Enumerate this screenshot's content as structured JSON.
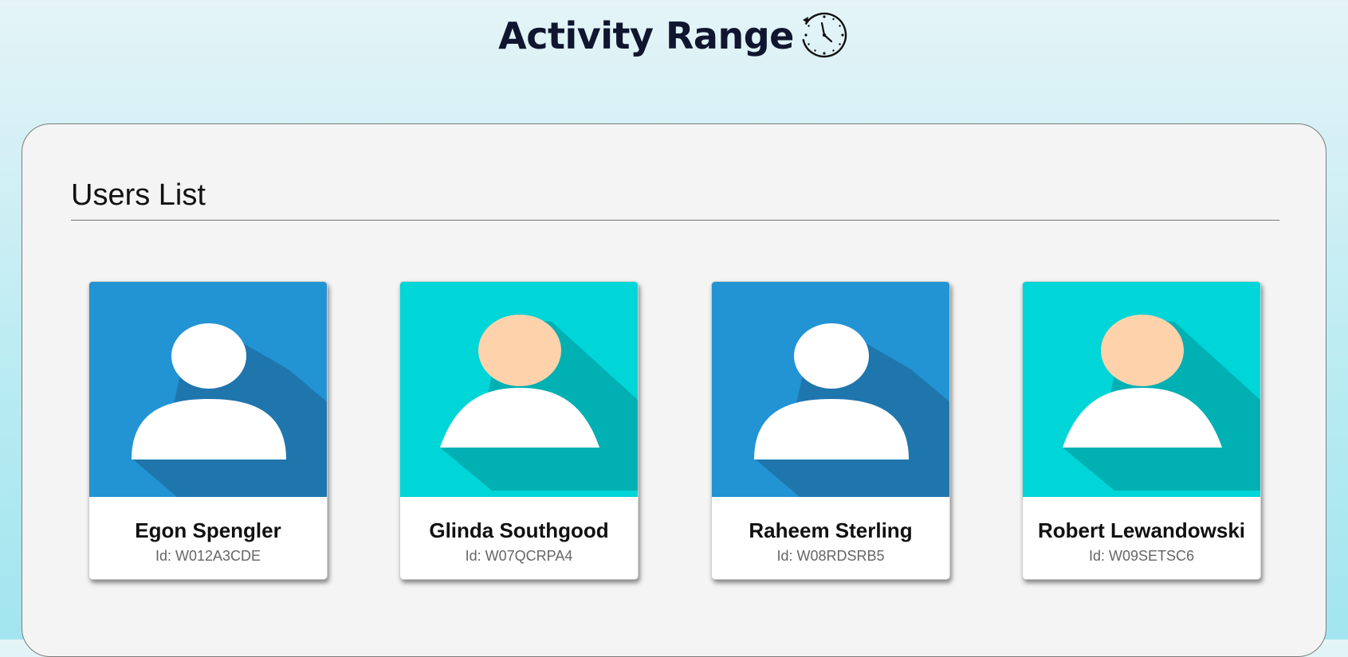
{
  "app": {
    "title": "Activity Range"
  },
  "users_section": {
    "title": "Users List",
    "id_prefix": "Id:",
    "users": [
      {
        "name": "Egon Spengler",
        "id": "W012A3CDE",
        "avatar": "male-avatar-icon"
      },
      {
        "name": "Glinda Southgood",
        "id": "W07QCRPA4",
        "avatar": "female-avatar-icon"
      },
      {
        "name": "Raheem Sterling",
        "id": "W08RDSRB5",
        "avatar": "male-avatar-icon"
      },
      {
        "name": "Robert Lewandowski",
        "id": "W09SETSC6",
        "avatar": "female-avatar-icon"
      }
    ]
  },
  "colors": {
    "title_text": "#101630",
    "male_bg": "#2293d3",
    "male_shadow": "#1f76ad",
    "female_bg": "#00d5d7",
    "female_shadow": "#00b0b3",
    "skin": "#fed2ab",
    "panel_bg": "#f3f4f3"
  }
}
